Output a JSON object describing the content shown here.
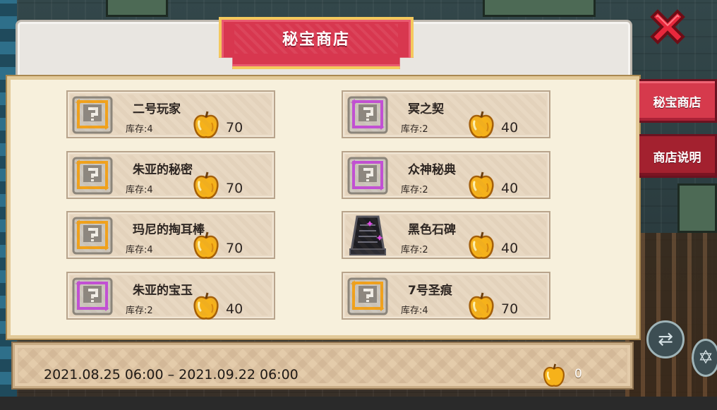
{
  "shop": {
    "title": "秘宝商店",
    "tabs": [
      {
        "label": "秘宝商店",
        "active": true
      },
      {
        "label": "商店说明",
        "active": false
      }
    ],
    "items": [
      {
        "name": "二号玩家",
        "stock": "库存:4",
        "price": "70",
        "frame": "gold"
      },
      {
        "name": "冥之契",
        "stock": "库存:2",
        "price": "40",
        "frame": "purple"
      },
      {
        "name": "朱亚的秘密",
        "stock": "库存:4",
        "price": "70",
        "frame": "gold"
      },
      {
        "name": "众神秘典",
        "stock": "库存:2",
        "price": "40",
        "frame": "purple"
      },
      {
        "name": "玛尼的掏耳棒",
        "stock": "库存:4",
        "price": "70",
        "frame": "gold"
      },
      {
        "name": "黑色石碑",
        "stock": "库存:2",
        "price": "40",
        "frame": "tablet"
      },
      {
        "name": "朱亚的宝玉",
        "stock": "库存:2",
        "price": "40",
        "frame": "purple"
      },
      {
        "name": "7号圣痕",
        "stock": "库存:4",
        "price": "70",
        "frame": "gold"
      }
    ],
    "period": "2021.08.25 06:00 – 2021.09.22 06:00",
    "currency_balance": "0"
  },
  "colors": {
    "gold_frame": "#f2a21b",
    "purple_frame": "#c24fd6",
    "banner_red": "#d8374f",
    "coin": "#f6b21a"
  },
  "icons": {
    "close": "close-x-icon",
    "currency": "golden-apple-icon",
    "mystery": "question-block-icon"
  }
}
